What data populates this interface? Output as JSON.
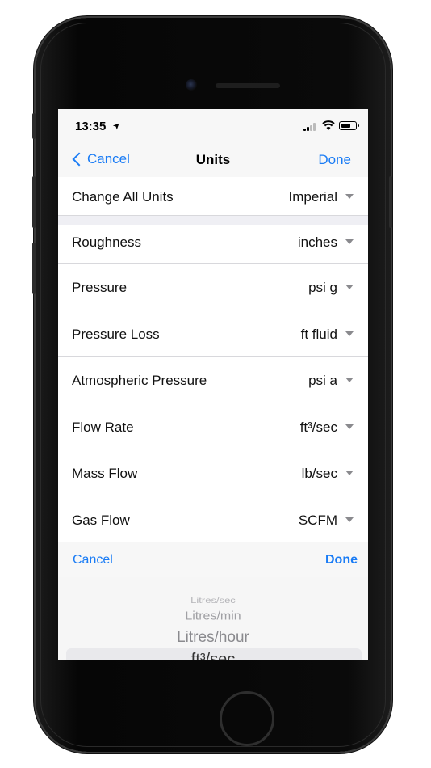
{
  "status_bar": {
    "time": "13:35"
  },
  "nav": {
    "back_label": "Cancel",
    "title": "Units",
    "done_label": "Done"
  },
  "change_all": {
    "label": "Change All Units",
    "value": "Imperial"
  },
  "rows": [
    {
      "label": "Roughness",
      "value": "inches"
    },
    {
      "label": "Pressure",
      "value": "psi g"
    },
    {
      "label": "Pressure Loss",
      "value": "ft fluid"
    },
    {
      "label": "Atmospheric Pressure",
      "value": "psi a"
    },
    {
      "label": "Flow Rate",
      "value": "ft³/sec"
    },
    {
      "label": "Mass Flow",
      "value": "lb/sec"
    },
    {
      "label": "Gas Flow",
      "value": "SCFM"
    }
  ],
  "toolbar": {
    "cancel_label": "Cancel",
    "done_label": "Done"
  },
  "picker": {
    "items": [
      "Litres/sec",
      "Litres/min",
      "Litres/hour",
      "ft³/sec"
    ]
  },
  "colors": {
    "accent": "#1a7cf5"
  }
}
